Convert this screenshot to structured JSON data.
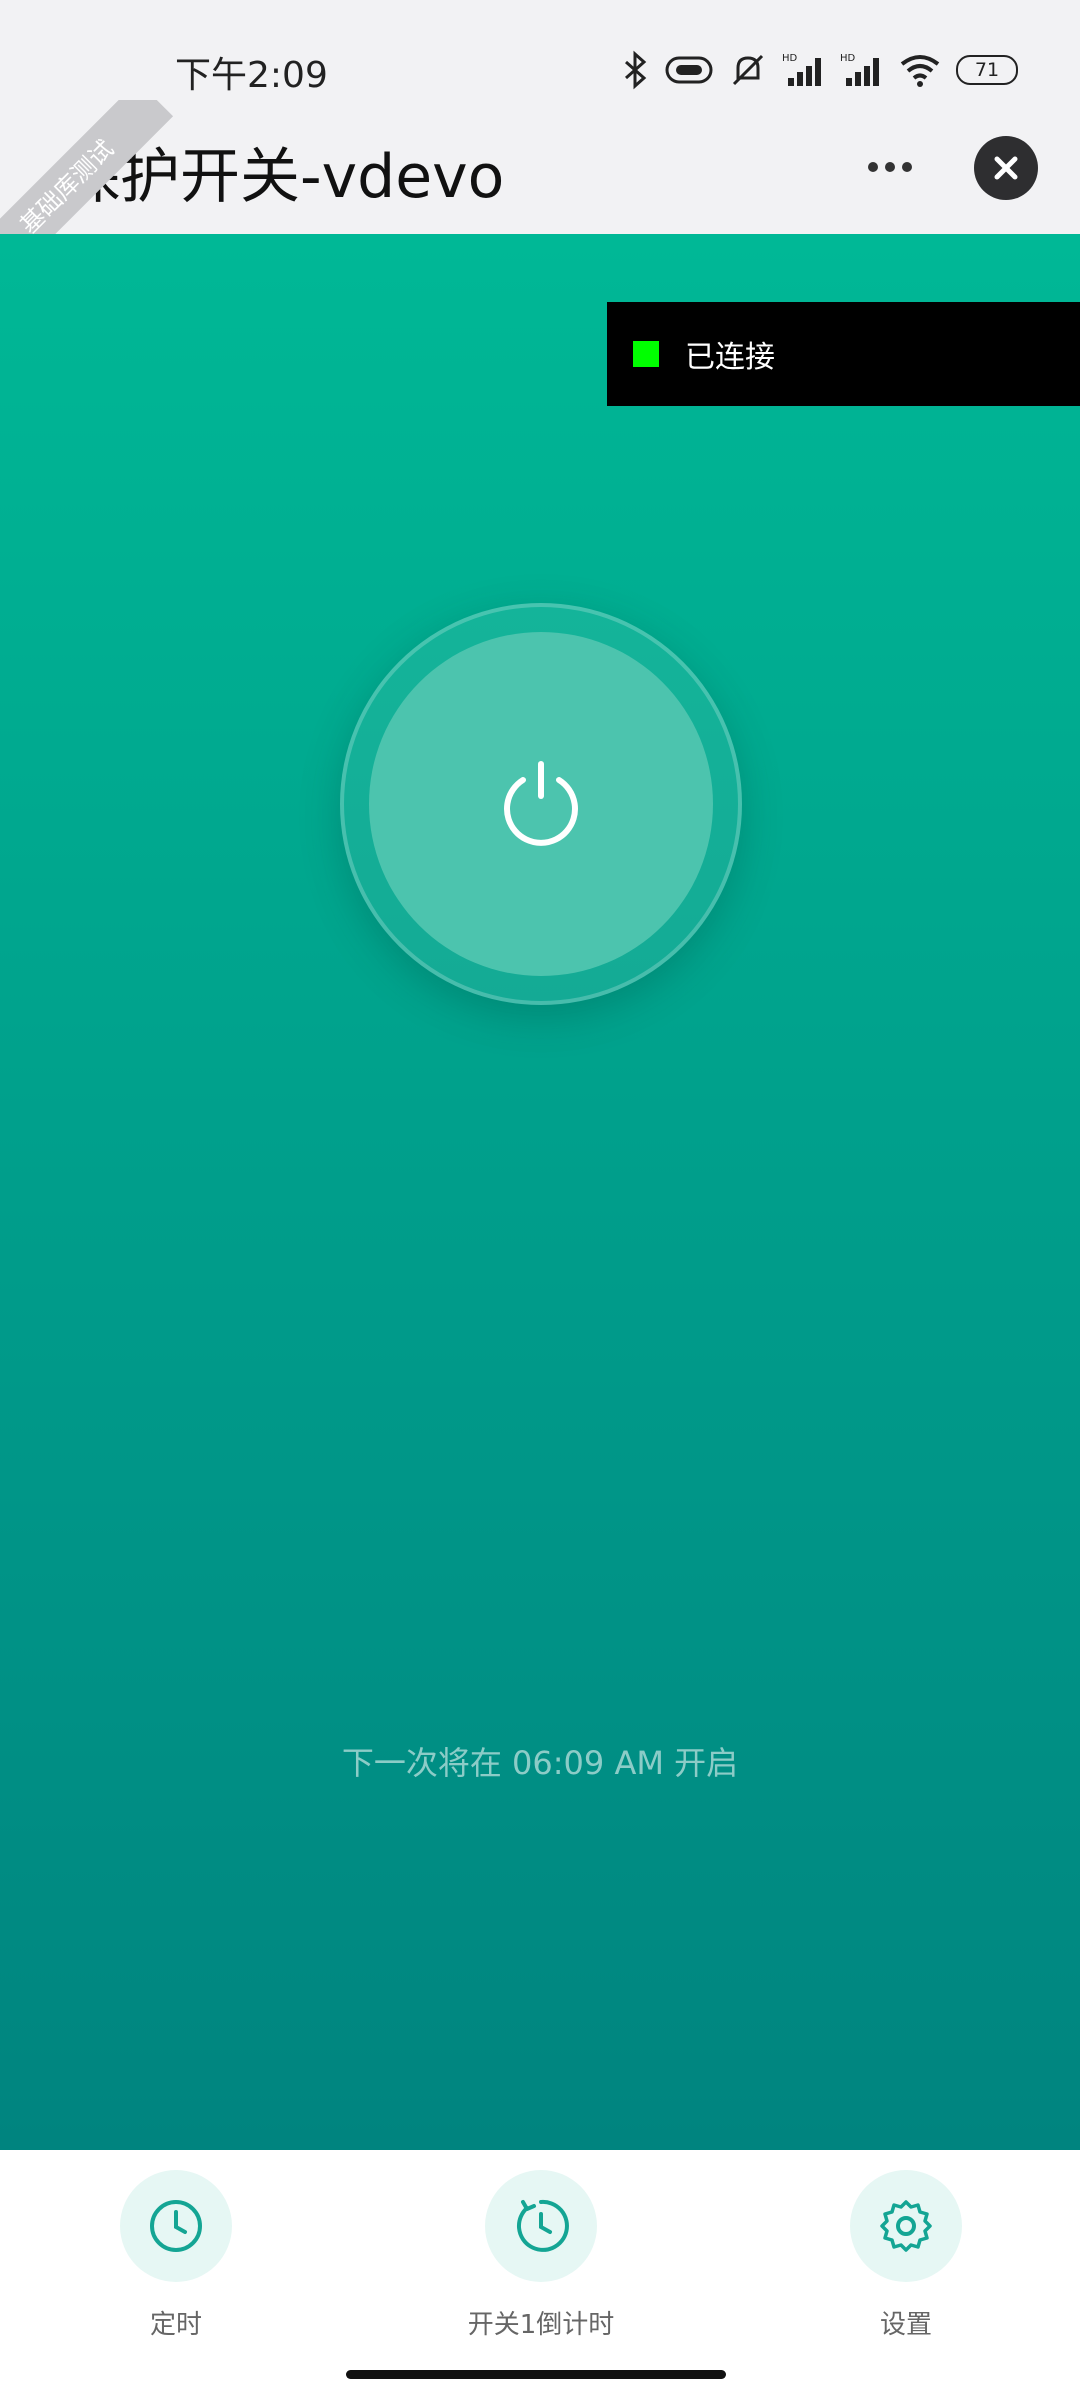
{
  "status_bar": {
    "time": "下午2:09",
    "battery": "71",
    "icons": [
      "bluetooth-icon",
      "link-icon",
      "mute-icon",
      "signal-hd-icon",
      "signal-hd-icon",
      "wifi-icon",
      "battery-icon"
    ],
    "hd_label": "HD"
  },
  "header": {
    "ribbon": "基础库测试",
    "title": "保护开关-vdevo",
    "more_icon": "more-icon",
    "close_icon": "close-icon"
  },
  "connection": {
    "status": "已连接",
    "indicator_color": "#00ff00"
  },
  "main": {
    "power_icon": "power-icon",
    "next_schedule": "下一次将在 06:09 AM 开启",
    "accent_color": "#00b896"
  },
  "bottom_nav": {
    "items": [
      {
        "label": "定时",
        "icon": "clock-icon"
      },
      {
        "label": "开关1倒计时",
        "icon": "countdown-icon"
      },
      {
        "label": "设置",
        "icon": "gear-icon"
      }
    ]
  }
}
